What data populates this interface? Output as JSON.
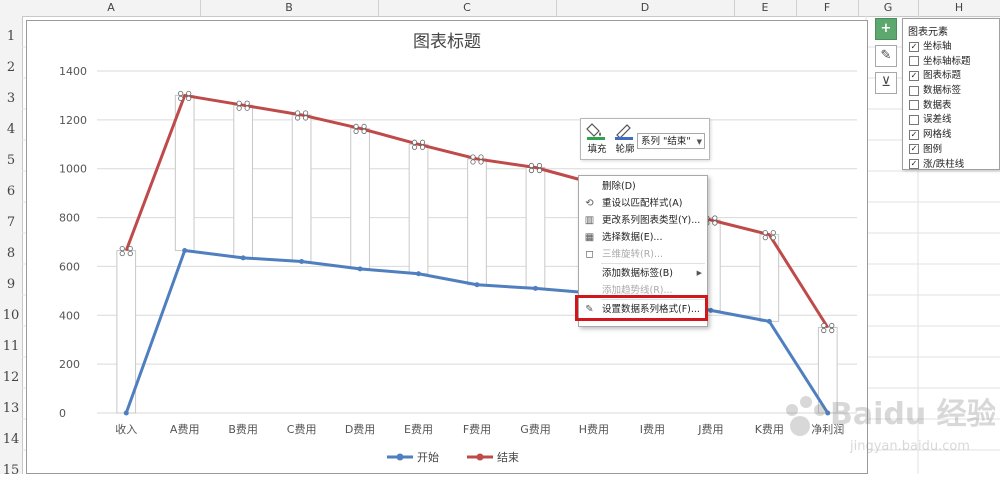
{
  "sheet": {
    "columns": [
      {
        "label": "A",
        "left": 0,
        "width": 0
      },
      {
        "label": "B"
      },
      {
        "label": "C"
      },
      {
        "label": "D"
      },
      {
        "label": "E"
      },
      {
        "label": "F"
      },
      {
        "label": "G"
      },
      {
        "label": "H"
      }
    ],
    "rows": [
      "1",
      "2",
      "3",
      "4",
      "5",
      "6",
      "7",
      "8",
      "9",
      "10",
      "11",
      "12",
      "13",
      "14",
      "15"
    ]
  },
  "chart_data": {
    "type": "line",
    "title": "图表标题",
    "categories": [
      "收入",
      "A费用",
      "B费用",
      "C费用",
      "D费用",
      "E费用",
      "F费用",
      "G费用",
      "H费用",
      "I费用",
      "J费用",
      "K费用",
      "净利润"
    ],
    "series": [
      {
        "name": "开始",
        "color": "#4f7fbf",
        "values": [
          0,
          665,
          635,
          620,
          590,
          570,
          525,
          510,
          490,
          470,
          420,
          375,
          0
        ]
      },
      {
        "name": "结束",
        "color": "#bf4a4a",
        "values": [
          665,
          1300,
          1260,
          1220,
          1165,
          1100,
          1040,
          1005,
          940,
          870,
          790,
          730,
          350
        ]
      }
    ],
    "ylim": [
      0,
      1400
    ],
    "yticks": [
      "0",
      "200",
      "400",
      "600",
      "800",
      "1000",
      "1200",
      "1400"
    ],
    "grid": true,
    "legend": "bottom",
    "updown_bars": true,
    "selected_series": "结束"
  },
  "side_buttons": {
    "plus": "+",
    "brush": "✎",
    "filter": "⊻"
  },
  "elements_panel": {
    "title": "图表元素",
    "items": [
      {
        "label": "坐标轴",
        "checked": true
      },
      {
        "label": "坐标轴标题",
        "checked": false
      },
      {
        "label": "图表标题",
        "checked": true
      },
      {
        "label": "数据标签",
        "checked": false
      },
      {
        "label": "数据表",
        "checked": false
      },
      {
        "label": "误差线",
        "checked": false
      },
      {
        "label": "网格线",
        "checked": true
      },
      {
        "label": "图例",
        "checked": true
      },
      {
        "label": "涨/跌柱线",
        "checked": true
      }
    ]
  },
  "mini_toolbar": {
    "fill_label": "填充",
    "outline_label": "轮廓",
    "series_value": "系列 \"结束\"",
    "fill_color": "#2fa44f",
    "outline_color": "#3b6fc4"
  },
  "context_menu": {
    "items": [
      {
        "label": "删除(D)",
        "disabled": false,
        "icon": ""
      },
      {
        "label": "重设以匹配样式(A)",
        "disabled": false,
        "icon": "⟲"
      },
      {
        "label": "更改系列图表类型(Y)...",
        "disabled": false,
        "icon": "▥"
      },
      {
        "label": "选择数据(E)...",
        "disabled": false,
        "icon": "▦"
      },
      {
        "label": "三维旋转(R)...",
        "disabled": true,
        "icon": "◻"
      },
      {
        "label": "添加数据标签(B)",
        "disabled": false,
        "icon": "",
        "submenu": "▶"
      },
      {
        "label": "添加趋势线(R)...",
        "disabled": true,
        "icon": ""
      },
      {
        "label": "设置数据系列格式(F)...",
        "disabled": false,
        "icon": "✎"
      }
    ]
  },
  "watermark": {
    "text": "Baidu 经验",
    "sub": "jingyan.baidu.com"
  }
}
